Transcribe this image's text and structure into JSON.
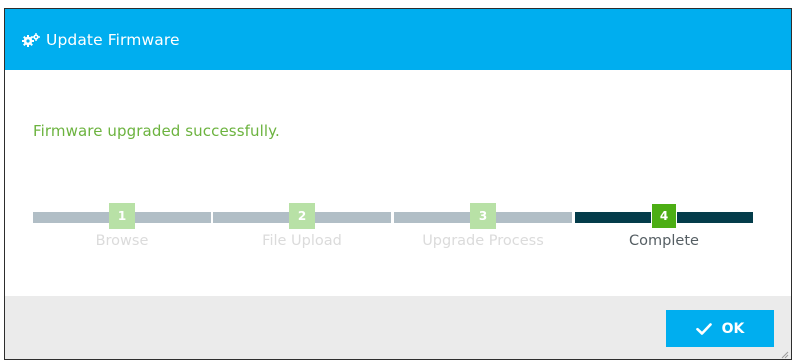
{
  "dialog": {
    "title": "Update Firmware",
    "header_icon": "gears-icon",
    "message": "Firmware upgraded successfully.",
    "colors": {
      "header": "#00aeef",
      "success_text": "#6cb33f",
      "step_active_bar": "#043c4a",
      "step_inactive_bar": "#b1bec6",
      "step_active_num": "#4cae14",
      "step_inactive_num": "#b8e1a6",
      "footer": "#ebebeb"
    }
  },
  "wizard": {
    "steps": [
      {
        "number": "1",
        "label": "Browse",
        "active": false
      },
      {
        "number": "2",
        "label": "File Upload",
        "active": false
      },
      {
        "number": "3",
        "label": "Upgrade Process",
        "active": false
      },
      {
        "number": "4",
        "label": "Complete",
        "active": true
      }
    ]
  },
  "footer": {
    "ok_label": "OK",
    "ok_icon": "checkmark-icon"
  }
}
